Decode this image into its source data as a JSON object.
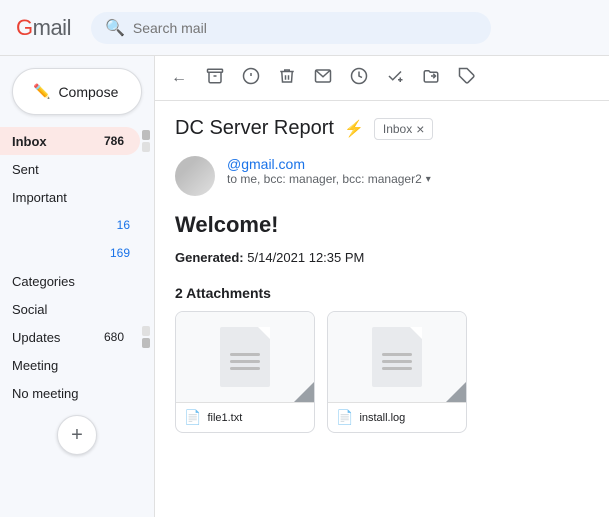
{
  "topbar": {
    "logo": "Gmail",
    "search_placeholder": "Search mail"
  },
  "sidebar": {
    "compose_label": "Compose",
    "scroll_counts": {
      "inbox_count": "786"
    },
    "items": [
      {
        "label": "Inbox",
        "count": "786",
        "active": true,
        "count_color": "normal"
      },
      {
        "label": "Sent",
        "count": "",
        "active": false
      },
      {
        "label": "Important",
        "count": "",
        "active": false
      },
      {
        "label": "",
        "count": "16",
        "active": false
      },
      {
        "label": "",
        "count": "169",
        "active": false
      },
      {
        "label": "Categories",
        "count": "",
        "active": false
      },
      {
        "label": "Social",
        "count": "",
        "active": false
      },
      {
        "label": "Updates",
        "count": "680",
        "active": false
      },
      {
        "label": "Meeting",
        "count": "",
        "active": false
      },
      {
        "label": "No meeting",
        "count": "",
        "active": false
      }
    ],
    "more_label": "+"
  },
  "toolbar": {
    "back_label": "←",
    "archive_icon": "⬜",
    "spam_icon": "⚠",
    "delete_icon": "🗑",
    "mail_icon": "✉",
    "clock_icon": "🕐",
    "check_icon": "✓",
    "move_icon": "📁",
    "label_icon": "🏷"
  },
  "email": {
    "subject": "DC Server Report",
    "lightning": "⚡",
    "inbox_badge": "Inbox",
    "sender_email": "@gmail.com",
    "to_text": "to me, bcc: manager, bcc: manager2",
    "greeting": "Welcome!",
    "generated_label": "Generated:",
    "generated_value": "5/14/2021 12:35 PM",
    "attachments_title": "2 Attachments",
    "attachments": [
      {
        "filename": "file1.txt",
        "icon": "📄"
      },
      {
        "filename": "install.log",
        "icon": "📄"
      }
    ]
  }
}
